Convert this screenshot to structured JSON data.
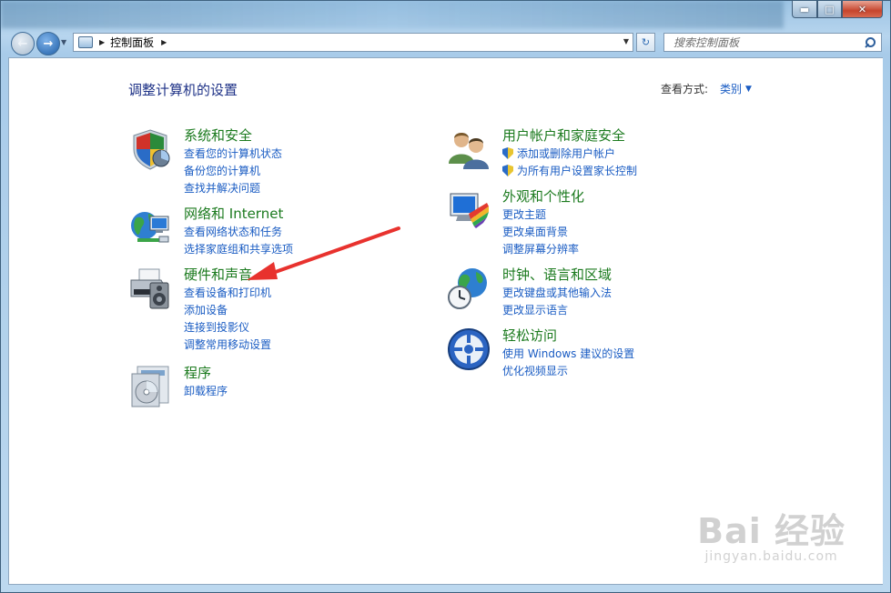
{
  "window": {
    "min_glyph": "▬",
    "max_glyph": "□",
    "close_glyph": "✕"
  },
  "nav": {
    "back_glyph": "←",
    "forward_glyph": "→",
    "dropdown_glyph": "▼",
    "refresh_glyph": "↻"
  },
  "address": {
    "separator": "▶",
    "location": "控制面板",
    "dropdown_glyph": "▼"
  },
  "search": {
    "placeholder": "搜索控制面板",
    "icon": "search-icon"
  },
  "page": {
    "title": "调整计算机的设置",
    "view_by_label": "查看方式:",
    "view_by_value": "类别",
    "view_by_caret": "▼"
  },
  "categories": [
    {
      "title": "系统和安全",
      "icon": "shield-icon",
      "links": [
        "查看您的计算机状态",
        "备份您的计算机",
        "查找并解决问题"
      ]
    },
    {
      "title": "网络和 Internet",
      "icon": "network-globe-icon",
      "links": [
        "查看网络状态和任务",
        "选择家庭组和共享选项"
      ]
    },
    {
      "title": "硬件和声音",
      "icon": "printer-speaker-icon",
      "links": [
        "查看设备和打印机",
        "添加设备",
        "连接到投影仪",
        "调整常用移动设置"
      ]
    },
    {
      "title": "程序",
      "icon": "programs-disc-icon",
      "links": [
        "卸载程序"
      ]
    },
    {
      "title": "用户帐户和家庭安全",
      "icon": "users-icon",
      "links": [
        "添加或删除用户帐户",
        "为所有用户设置家长控制"
      ]
    },
    {
      "title": "外观和个性化",
      "icon": "monitor-palette-icon",
      "links": [
        "更改主题",
        "更改桌面背景",
        "调整屏幕分辨率"
      ]
    },
    {
      "title": "时钟、语言和区域",
      "icon": "clock-globe-icon",
      "links": [
        "更改键盘或其他输入法",
        "更改显示语言"
      ]
    },
    {
      "title": "轻松访问",
      "icon": "ease-of-access-icon",
      "links": [
        "使用 Windows 建议的设置",
        "优化视频显示"
      ]
    }
  ],
  "watermark": {
    "main": "Bai 经验",
    "sub": "jingyan.baidu.com"
  },
  "annotation": {
    "arrow_color": "#e8322e"
  }
}
